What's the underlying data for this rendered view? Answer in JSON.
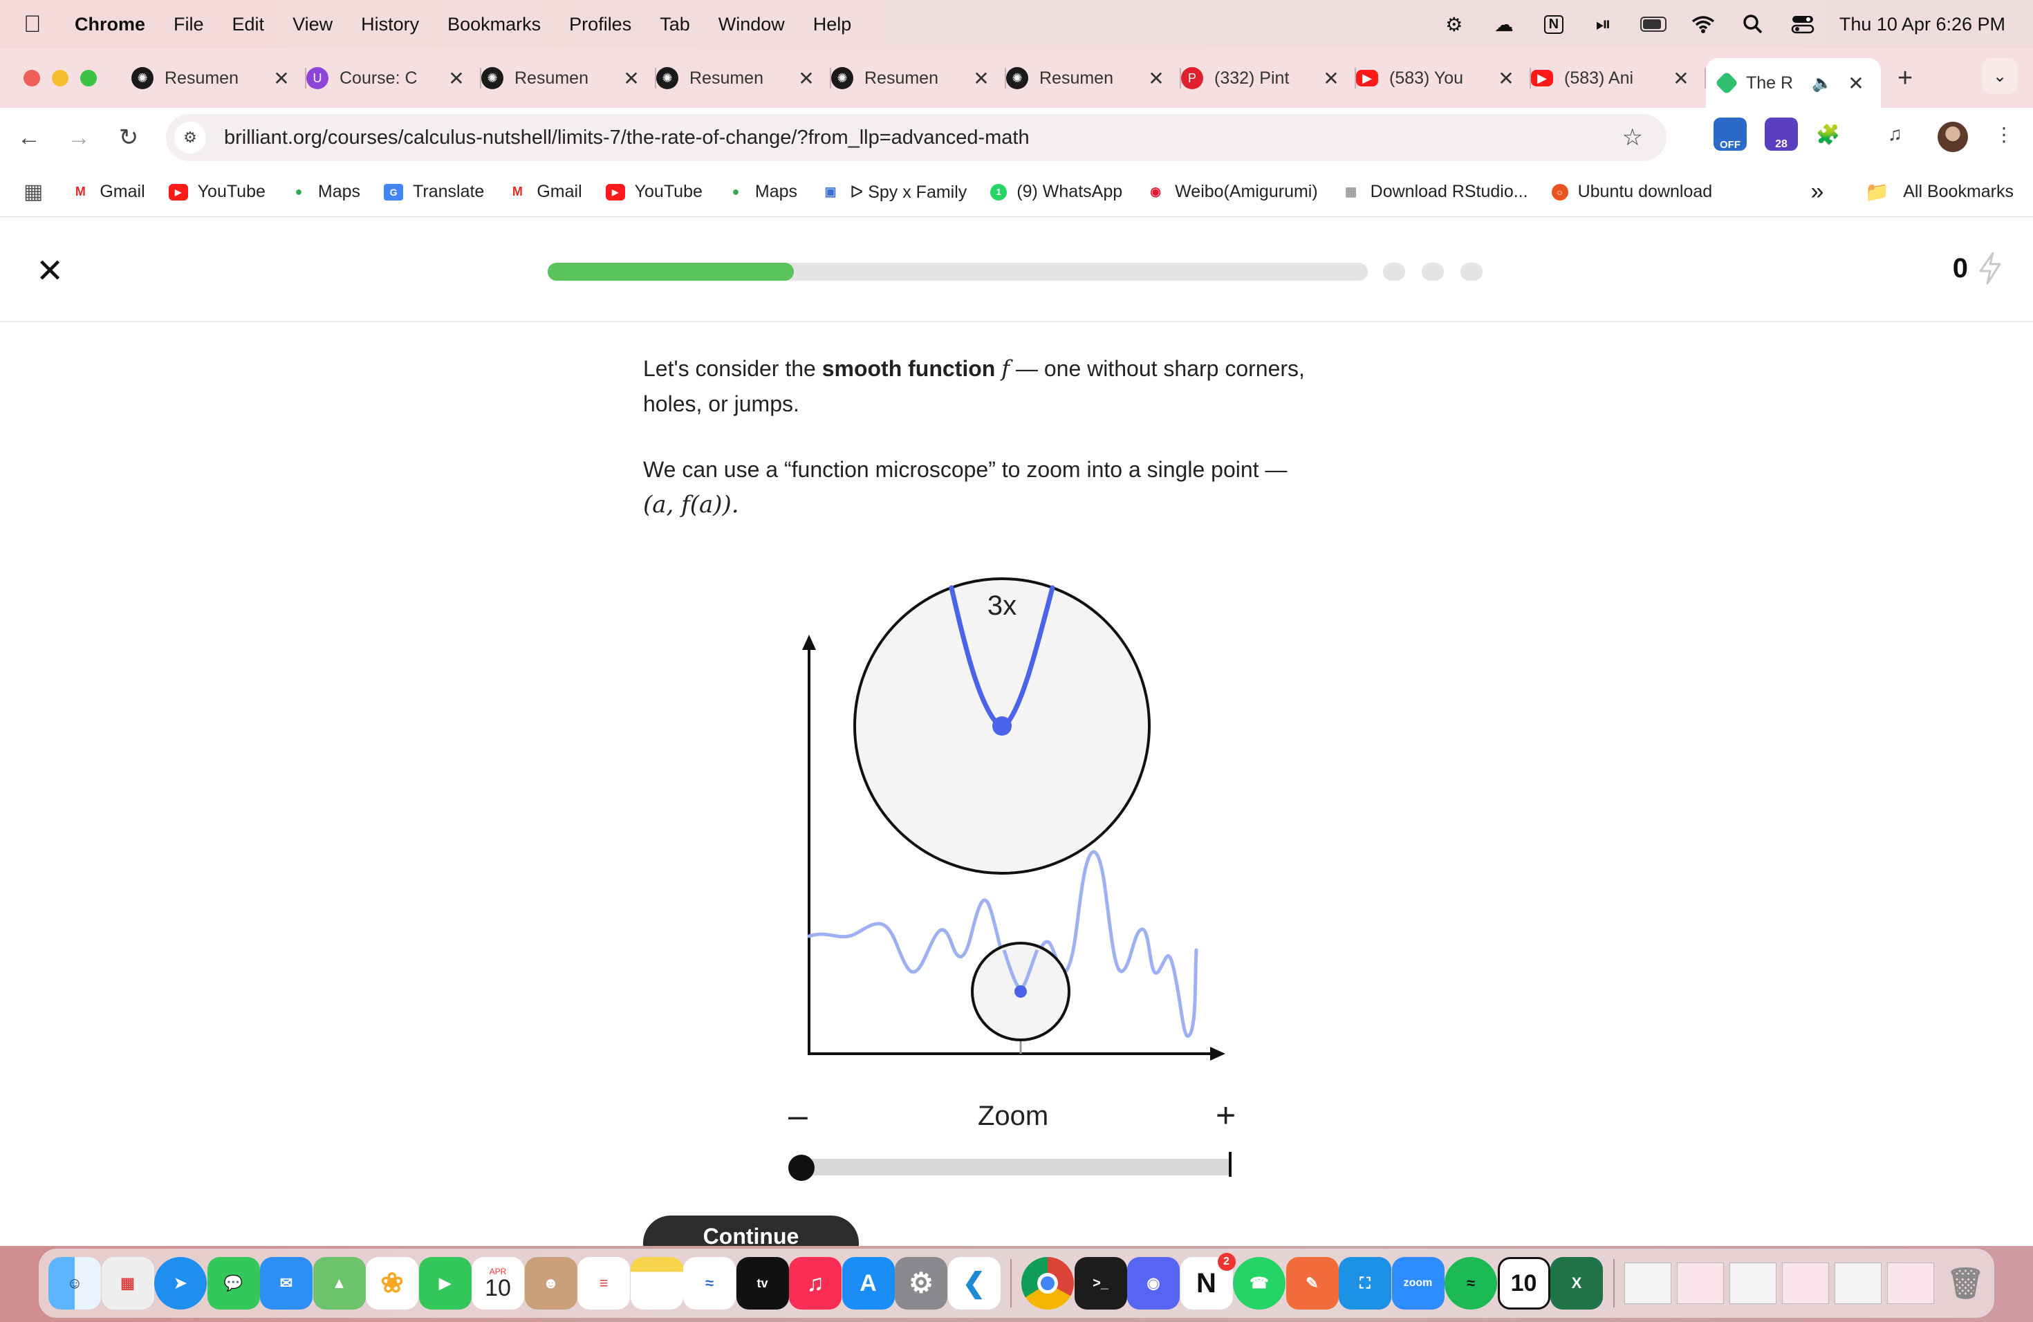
{
  "menubar": {
    "app": "Chrome",
    "items": [
      "File",
      "Edit",
      "View",
      "History",
      "Bookmarks",
      "Profiles",
      "Tab",
      "Window",
      "Help"
    ],
    "clock": "Thu 10 Apr  6:26 PM",
    "icons": [
      "pin-icon",
      "cloud-icon",
      "notion-icon",
      "play-icon",
      "battery-icon",
      "wifi-icon",
      "spotlight-icon",
      "control-center-icon"
    ]
  },
  "tabs": [
    {
      "title": "Resumen",
      "icon": "openai-icon"
    },
    {
      "title": "Course: C",
      "icon": "udemy-icon"
    },
    {
      "title": "Resumen",
      "icon": "openai-icon"
    },
    {
      "title": "Resumen",
      "icon": "openai-icon"
    },
    {
      "title": "Resumen",
      "icon": "openai-icon"
    },
    {
      "title": "Resumen",
      "icon": "openai-icon"
    },
    {
      "title": "(332) Pint",
      "icon": "pinterest-icon"
    },
    {
      "title": "(583) You",
      "icon": "youtube-icon"
    },
    {
      "title": "(583) Ani",
      "icon": "youtube-icon"
    },
    {
      "title": "The R",
      "icon": "brilliant-icon",
      "active": true
    }
  ],
  "toolbar": {
    "url": "brilliant.org/courses/calculus-nutshell/limits-7/the-rate-of-change/?from_llp=advanced-math",
    "ext_off": "OFF",
    "ext_badge": "28"
  },
  "bookmarks": {
    "items": [
      "Gmail",
      "YouTube",
      "Maps",
      "Translate",
      "Gmail",
      "YouTube",
      "Maps",
      "ᐅ Spy x Family",
      "(9) WhatsApp",
      "Weibo(Amigurumi)",
      "Download RStudio...",
      "Ubuntu download"
    ],
    "overflow": "»",
    "all": "All Bookmarks"
  },
  "lesson": {
    "progress": 0.3,
    "energy": "0",
    "p1_before": "Let's consider the ",
    "p1_bold": "smooth function",
    "p1_var": "f",
    "p1_after": " — one without sharp corners, holes, or jumps.",
    "p2": "We can use a “function microscope” to zoom into a single point —",
    "p2_math": "(a, f(a)).",
    "magnification": "3x",
    "zoom_label": "Zoom",
    "zoom_minus": "–",
    "zoom_plus": "+",
    "zoom_level": 0,
    "continue": "Continue"
  },
  "colors": {
    "progress_fill": "#5bc35b",
    "curve_light": "#9fb0f2",
    "curve_strong": "#4a63e8",
    "point": "#4a63e8"
  },
  "dock": {
    "calendar_month": "APR",
    "calendar_day": "10",
    "discord_badge": "2",
    "apps": [
      "finder",
      "launchpad",
      "safari",
      "messages",
      "mail",
      "maps",
      "photos",
      "facetime",
      "calendar",
      "contacts",
      "reminders",
      "notes",
      "freeform",
      "tv",
      "music",
      "app-store",
      "system-settings",
      "vscode",
      "chrome",
      "terminal",
      "discord",
      "notion",
      "whatsapp",
      "pencil",
      "docker",
      "zoom",
      "spotify",
      "numbers",
      "excel"
    ]
  }
}
